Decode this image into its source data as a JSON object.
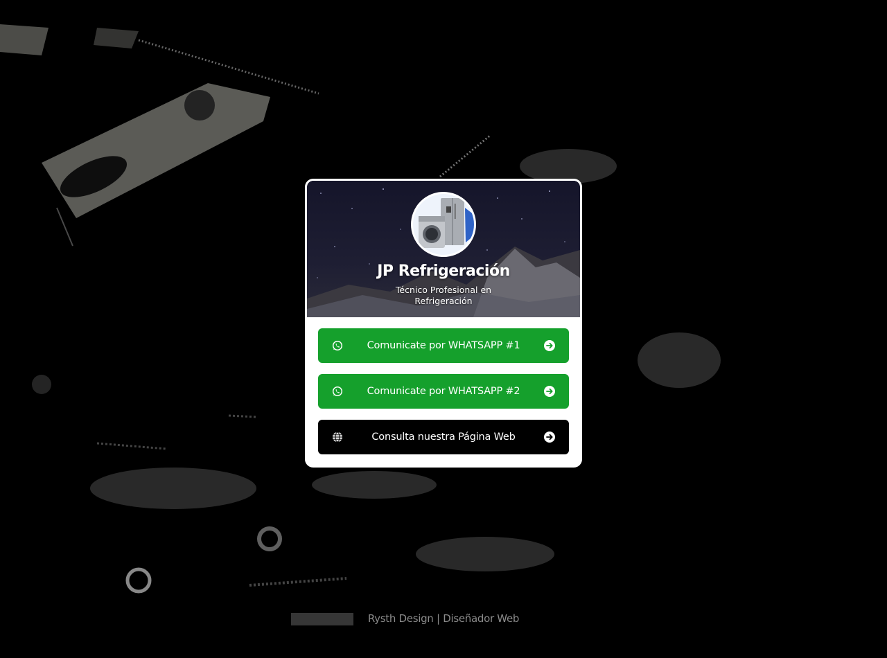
{
  "profile": {
    "name": "JP Refrigeración",
    "subtitle": "Técnico Profesional en Refrigeración",
    "avatar_icon": "appliances-avatar"
  },
  "links": [
    {
      "label": "Comunicate por WHATSAPP #1",
      "icon": "whatsapp-icon",
      "arrow": "arrow-right-circle-icon",
      "color": "#15a02c"
    },
    {
      "label": "Comunicate por WHATSAPP #2",
      "icon": "whatsapp-icon",
      "arrow": "arrow-right-circle-icon",
      "color": "#15a02c"
    },
    {
      "label": "Consulta nuestra Página Web",
      "icon": "globe-icon",
      "arrow": "arrow-right-circle-icon",
      "color": "#000000"
    }
  ],
  "footer": {
    "credit": "Rysth Design | Diseñador Web"
  },
  "colors": {
    "page_background": "#000000",
    "card_background": "#ffffff",
    "whatsapp_green": "#15a02c",
    "footer_text": "#8a8a8a"
  }
}
